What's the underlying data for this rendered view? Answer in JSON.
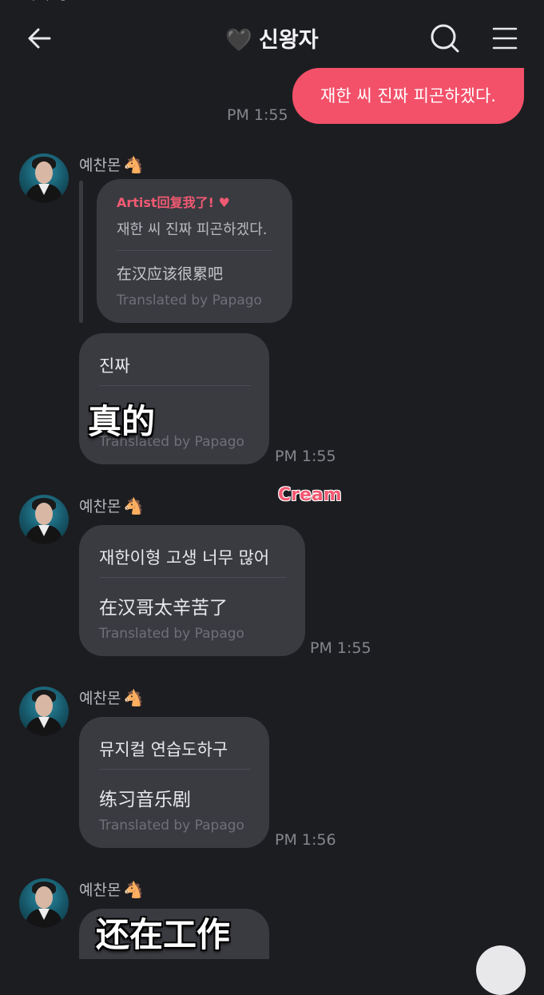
{
  "header": {
    "title": "신왕자",
    "heart": "🖤",
    "icons": [
      "back-arrow-icon",
      "search-icon",
      "menu-icon"
    ]
  },
  "top_sliver_text": "papago",
  "outgoing": {
    "text": "재한 씨 진짜 피곤하겠다.",
    "time": "PM 1:55",
    "color": "#f3506a"
  },
  "sender": {
    "name": "예찬몬",
    "emoji": "🐴"
  },
  "messages": [
    {
      "reply_tag": "Artist回复我了!",
      "reply_heart": "♥",
      "quoted": "재한 씨 진짜 피곤하겠다.",
      "translation": "在汉应该很累吧",
      "translated_by": "Translated by Papago"
    },
    {
      "text": "진짜",
      "overlay": "真的",
      "translated_by": "Translated by Papago",
      "time": "PM 1:55"
    },
    {
      "text": "재한이형 고생 너무 많어",
      "translation": "在汉哥太辛苦了",
      "translated_by": "Translated by Papago",
      "time": "PM 1:55"
    },
    {
      "text": "뮤지컬 연습도하구",
      "translation": "练习音乐剧",
      "translated_by": "Translated by Papago",
      "time": "PM 1:56"
    },
    {
      "overlay": "还在工作"
    }
  ],
  "watermark": "Cream",
  "colors": {
    "background": "#1c1d21",
    "bubble": "#3a3b41",
    "accent": "#f3506a"
  }
}
